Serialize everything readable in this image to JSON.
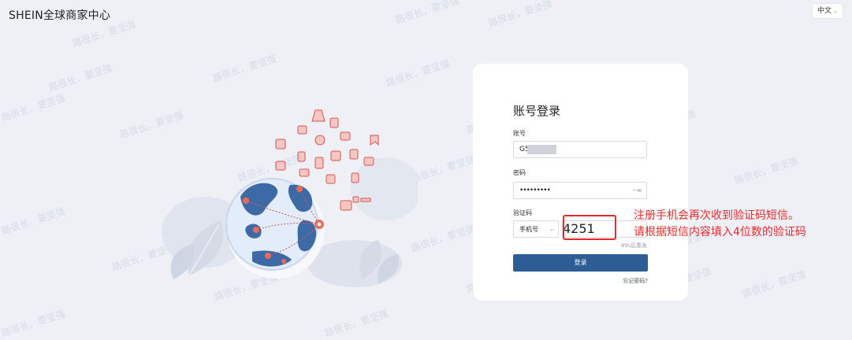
{
  "header": {
    "brand": "SHEIN全球商家中心",
    "lang_label": "中文"
  },
  "watermark": "路很长，要坚强",
  "login": {
    "title": "账号登录",
    "account_label": "账号",
    "account_value": "G5",
    "password_label": "密码",
    "password_value": "•••••••••",
    "password_toggle": "~w",
    "code_label": "验证码",
    "code_type": "手机号",
    "code_value": "4251",
    "resend_text": "49s后重发",
    "submit_label": "登录",
    "forgot_label": "忘记密码?"
  },
  "annotation": {
    "line1": "注册手机会再次收到验证码短信。",
    "line2": "请根据短信内容填入4位数的验证码"
  },
  "colors": {
    "background": "#eef0f6",
    "primary_button": "#2d5d95",
    "annotation": "#e8292b",
    "globe_land": "#3d6aa4",
    "globe_sea": "#e2ecfa"
  }
}
